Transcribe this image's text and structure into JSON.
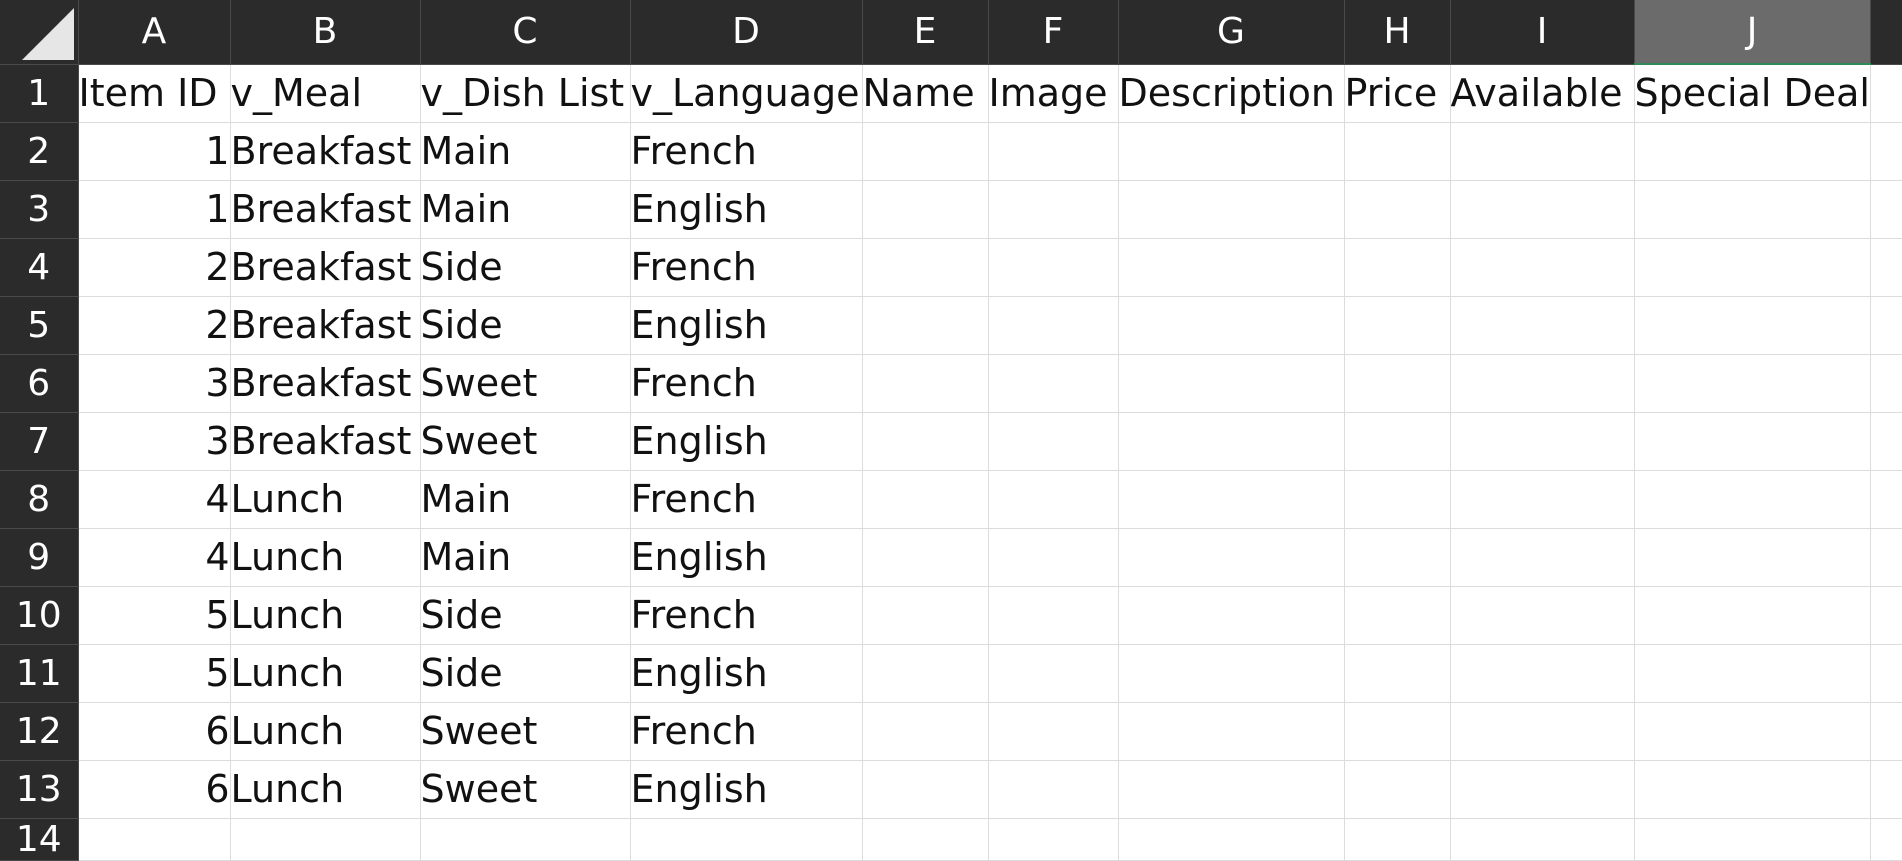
{
  "corner": {
    "icon": "select-all-triangle-icon"
  },
  "columns": [
    {
      "letter": "A",
      "header": "Item ID"
    },
    {
      "letter": "B",
      "header": "v_Meal"
    },
    {
      "letter": "C",
      "header": "v_Dish List"
    },
    {
      "letter": "D",
      "header": "v_Language"
    },
    {
      "letter": "E",
      "header": "Name"
    },
    {
      "letter": "F",
      "header": "Image"
    },
    {
      "letter": "G",
      "header": "Description"
    },
    {
      "letter": "H",
      "header": "Price"
    },
    {
      "letter": "I",
      "header": "Available"
    },
    {
      "letter": "J",
      "header": "Special Deal"
    }
  ],
  "selected_column": "J",
  "row_numbers": [
    "1",
    "2",
    "3",
    "4",
    "5",
    "6",
    "7",
    "8",
    "9",
    "10",
    "11",
    "12",
    "13",
    "14"
  ],
  "rows": [
    [
      "1",
      "Breakfast",
      "Main",
      "French",
      "",
      "",
      "",
      "",
      "",
      ""
    ],
    [
      "1",
      "Breakfast",
      "Main",
      "English",
      "",
      "",
      "",
      "",
      "",
      ""
    ],
    [
      "2",
      "Breakfast",
      "Side",
      "French",
      "",
      "",
      "",
      "",
      "",
      ""
    ],
    [
      "2",
      "Breakfast",
      "Side",
      "English",
      "",
      "",
      "",
      "",
      "",
      ""
    ],
    [
      "3",
      "Breakfast",
      "Sweet",
      "French",
      "",
      "",
      "",
      "",
      "",
      ""
    ],
    [
      "3",
      "Breakfast",
      "Sweet",
      "English",
      "",
      "",
      "",
      "",
      "",
      ""
    ],
    [
      "4",
      "Lunch",
      "Main",
      "French",
      "",
      "",
      "",
      "",
      "",
      ""
    ],
    [
      "4",
      "Lunch",
      "Main",
      "English",
      "",
      "",
      "",
      "",
      "",
      ""
    ],
    [
      "5",
      "Lunch",
      "Side",
      "French",
      "",
      "",
      "",
      "",
      "",
      ""
    ],
    [
      "5",
      "Lunch",
      "Side",
      "English",
      "",
      "",
      "",
      "",
      "",
      ""
    ],
    [
      "6",
      "Lunch",
      "Sweet",
      "French",
      "",
      "",
      "",
      "",
      "",
      ""
    ],
    [
      "6",
      "Lunch",
      "Sweet",
      "English",
      "",
      "",
      "",
      "",
      "",
      ""
    ],
    [
      "",
      "",
      "",
      "",
      "",
      "",
      "",
      "",
      "",
      ""
    ]
  ],
  "colors": {
    "header_bg": "#2b2b2b",
    "header_text": "#ffffff",
    "selected_header_bg": "#6b6b6b",
    "selection_accent": "#2e8b57",
    "gridline": "#dcdcdc"
  }
}
